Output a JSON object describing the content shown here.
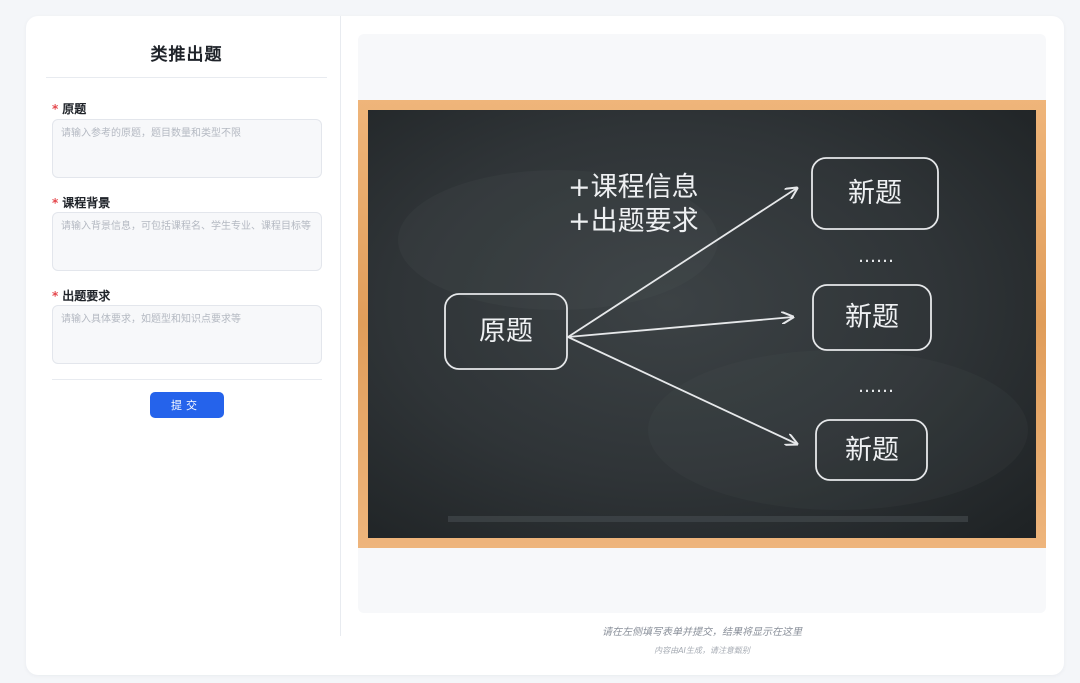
{
  "form": {
    "title": "类推出题",
    "required_mark": "*",
    "fields": [
      {
        "label": "原题",
        "placeholder": "请输入参考的原题，题目数量和类型不限",
        "value": ""
      },
      {
        "label": "课程背景",
        "placeholder": "请输入背景信息，可包括课程名、学生专业、课程目标等",
        "value": ""
      },
      {
        "label": "出题要求",
        "placeholder": "请输入具体要求，如题型和知识点要求等",
        "value": ""
      }
    ],
    "submit_label": "提交"
  },
  "illustration": {
    "original_box": "原题",
    "annotation_line1": "+课程信息",
    "annotation_line2": "+出题要求",
    "new_box_1": "新题",
    "new_box_2": "新题",
    "new_box_3": "新题",
    "dots": "……"
  },
  "result": {
    "hint": "请在左侧填写表单并提交，结果将显示在这里",
    "disclaimer": "内容由AI生成，请注意甄别"
  },
  "colors": {
    "primary": "#2563eb",
    "required": "#e5484d",
    "chalkboard": "#2c3134",
    "frame": "#e3a15e"
  }
}
